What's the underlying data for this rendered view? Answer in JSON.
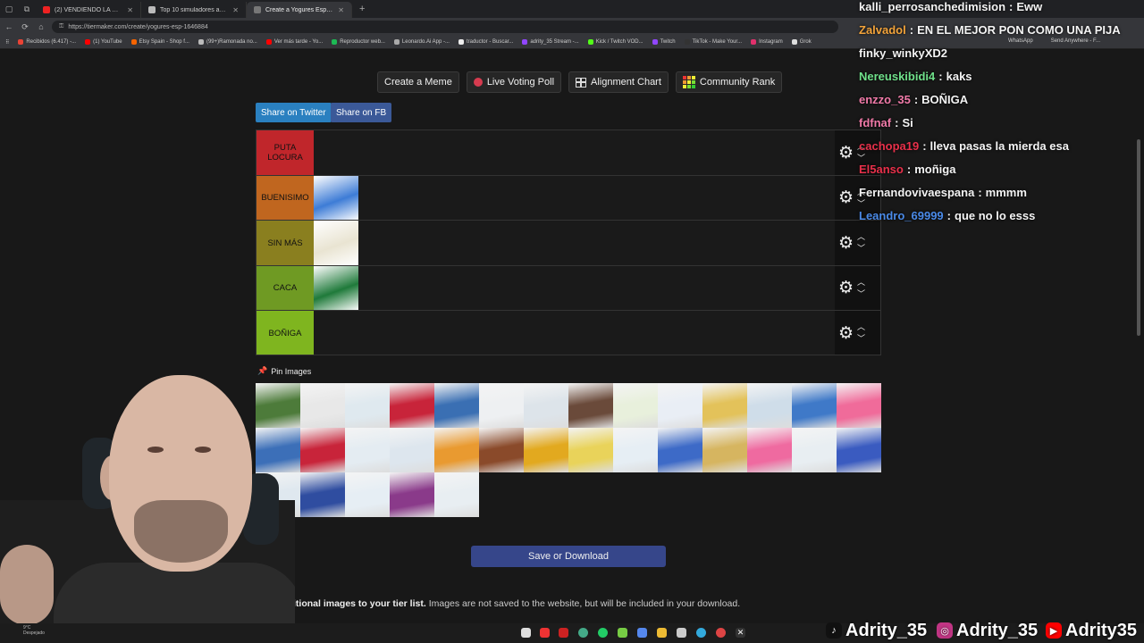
{
  "browser": {
    "tabs": [
      {
        "title": "(2) VENDIENDO LA MEJOR HAMB",
        "color": "#e22"
      },
      {
        "title": "Top 10 simuladores adictivos",
        "color": "#bbb"
      },
      {
        "title": "Create a Yogures Esp Tier List - Ti",
        "color": "#777"
      }
    ],
    "url": "https://tiermaker.com/create/yogures-esp-1646884",
    "bookmarks": [
      {
        "label": "Recibidos (6.417) -...",
        "color": "#ea4335"
      },
      {
        "label": "(1) YouTube",
        "color": "#f00"
      },
      {
        "label": "Etsy Spain - Shop f...",
        "color": "#f56400"
      },
      {
        "label": "(99+)Ramonada no...",
        "color": "#bbb"
      },
      {
        "label": "Ver más tarde - Yo...",
        "color": "#f00"
      },
      {
        "label": "Reproductor web...",
        "color": "#1db954"
      },
      {
        "label": "Leonardo.Ai App -...",
        "color": "#aaa"
      },
      {
        "label": "traductor - Buscar...",
        "color": "#eee"
      },
      {
        "label": "adrity_35 Stream -...",
        "color": "#9146ff"
      },
      {
        "label": "Kick / Twitch VOD...",
        "color": "#53fc18"
      },
      {
        "label": "Twitch",
        "color": "#9146ff"
      },
      {
        "label": "TikTok - Make Your...",
        "color": "#333"
      },
      {
        "label": "Instagram",
        "color": "#e1306c"
      },
      {
        "label": "Grok",
        "color": "#ddd"
      }
    ],
    "overlay_bookmarks": [
      "WhatsApp",
      "Send Anywhere - F..."
    ]
  },
  "toolbar": {
    "create_meme": "Create a Meme",
    "live_voting": "Live Voting Poll",
    "alignment": "Alignment Chart",
    "community": "Community Rank"
  },
  "share": {
    "twitter": "Share on Twitter",
    "fb": "Share on FB"
  },
  "tiers": [
    {
      "label": "PUTA LOCURA",
      "color": "#c0262b",
      "items": []
    },
    {
      "label": "BUENISIMO",
      "color": "#c0661f",
      "items": [
        "#3d7cd6"
      ]
    },
    {
      "label": "SIN MÁS",
      "color": "#8a7f1f",
      "items": [
        "#e9e4d2"
      ]
    },
    {
      "label": "CACA",
      "color": "#6f9a23",
      "items": [
        "#1f7a3a"
      ]
    },
    {
      "label": "BOÑIGA",
      "color": "#7fb51f",
      "items": []
    }
  ],
  "pin_images": "Pin Images",
  "pool_colors": [
    "#4d7b3a",
    "#e8e8e8",
    "#dfe9ef",
    "#c8243a",
    "#3a6fb3",
    "#eef0f2",
    "#dde4ea",
    "#6a4a3a",
    "#e8f0dc",
    "#e9eef5",
    "#e3c25a",
    "#cfdde9",
    "#3f79c8",
    "#f06b9a",
    "#3c6fb8",
    "#c8243a",
    "#e4ecf2",
    "#dde6ee",
    "#e99a30",
    "#8a4a2a",
    "#e2a91f",
    "#e9d35a",
    "#e6eef4",
    "#3d6ac7",
    "#d6b560",
    "#ef6aa0",
    "#e8eef2",
    "#3a5bc0",
    "#dfe8ef",
    "#2f4da0",
    "#e6eef4",
    "#8a3a8a",
    "#e8eef2"
  ],
  "save": "Save or Download",
  "note_bold": "Add additional images to your tier list.",
  "note_rest": " Images are not saved to the website, but will be included in your download.",
  "chat": [
    {
      "user": "kalli_perrosanchedimision",
      "color": "#f3f3f3",
      "text": "Eww"
    },
    {
      "user": "Zalvadol",
      "color": "#f2a33a",
      "text": "EN EL MEJOR PON COMO UNA PIJA"
    },
    {
      "user": "finky_winkyXD2",
      "color": "#f2f2f2",
      "text": ""
    },
    {
      "user": "Nereuskibidi4",
      "color": "#6fe08a",
      "text": "kaks"
    },
    {
      "user": "enzzo_35",
      "color": "#f07aa8",
      "text": "BOÑIGA"
    },
    {
      "user": "fdfnaf",
      "color": "#f07aa8",
      "text": "Si"
    },
    {
      "user": "cachopa19",
      "color": "#e8304a",
      "text": "lleva pasas la mierda esa"
    },
    {
      "user": "El5anso",
      "color": "#e8304a",
      "text": "moñiga"
    },
    {
      "user": "Fernandovivaespana",
      "color": "#f2f2f2",
      "text": "mmmm"
    },
    {
      "user": "Leandro_69999",
      "color": "#4a8ae8",
      "text": "que no lo esss"
    }
  ],
  "social": {
    "tiktok": "Adrity_35",
    "instagram": "Adrity_35",
    "youtube": "Adrity35"
  },
  "icons": {
    "gear": "gear-icon",
    "up": "chevron-up-icon",
    "down": "chevron-down-icon"
  },
  "weather": {
    "temp": "9°C",
    "cond": "Despejado"
  }
}
